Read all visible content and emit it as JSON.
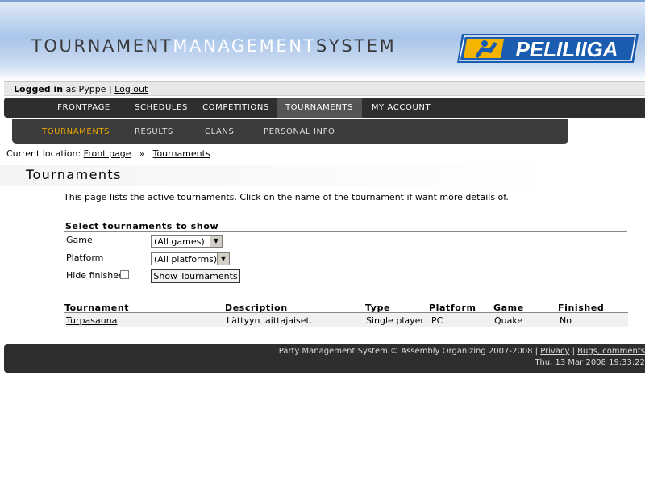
{
  "header": {
    "title_part1": "TOURNAMENT",
    "title_part2": "MANAGEMENT",
    "title_part3": "SYSTEM",
    "logo_text": "PELILIIGA"
  },
  "login": {
    "logged_in": "Logged in",
    "as_user": "as Pyppe",
    "separator": "|",
    "logout": "Log out"
  },
  "main_nav": [
    {
      "label": "FRONTPAGE",
      "active": false
    },
    {
      "label": "SCHEDULES",
      "active": false
    },
    {
      "label": "COMPETITIONS",
      "active": false
    },
    {
      "label": "TOURNAMENTS",
      "active": true
    },
    {
      "label": "MY ACCOUNT",
      "active": false
    }
  ],
  "sub_nav": [
    {
      "label": "TOURNAMENTS",
      "active": true
    },
    {
      "label": "RESULTS",
      "active": false
    },
    {
      "label": "CLANS",
      "active": false
    },
    {
      "label": "PERSONAL INFO",
      "active": false
    }
  ],
  "breadcrumb": {
    "prefix": "Current location:",
    "items": [
      "Front page",
      "Tournaments"
    ],
    "separator": "»"
  },
  "page": {
    "title": "Tournaments",
    "intro": "This page lists the active tournaments. Click on the name of the tournament if want more details of."
  },
  "filter": {
    "title": "Select tournaments to show",
    "game_label": "Game",
    "game_value": "(All games)",
    "platform_label": "Platform",
    "platform_value": "(All platforms)",
    "hide_finished_label": "Hide finished",
    "hide_finished_checked": false,
    "submit_label": "Show Tournaments"
  },
  "table": {
    "columns": [
      "Tournament",
      "Description",
      "Type",
      "Platform",
      "Game",
      "Finished"
    ],
    "rows": [
      [
        "Turpasauna",
        "Lättyyn laittajaiset.",
        "Single player",
        "PC",
        "Quake",
        "No"
      ]
    ]
  },
  "footer": {
    "text": "Party Management System © Assembly Organizing 2007-2008",
    "sep1": "|",
    "privacy": "Privacy",
    "sep2": "|",
    "bugs": "Bugs, comments",
    "timestamp": "Thu, 13 Mar 2008 19:33:22"
  },
  "colors": {
    "nav_bg": "#2e2e2e",
    "subnav_active": "#e8a500",
    "logo_blue": "#1a5cb0",
    "logo_yellow": "#f5b400"
  }
}
